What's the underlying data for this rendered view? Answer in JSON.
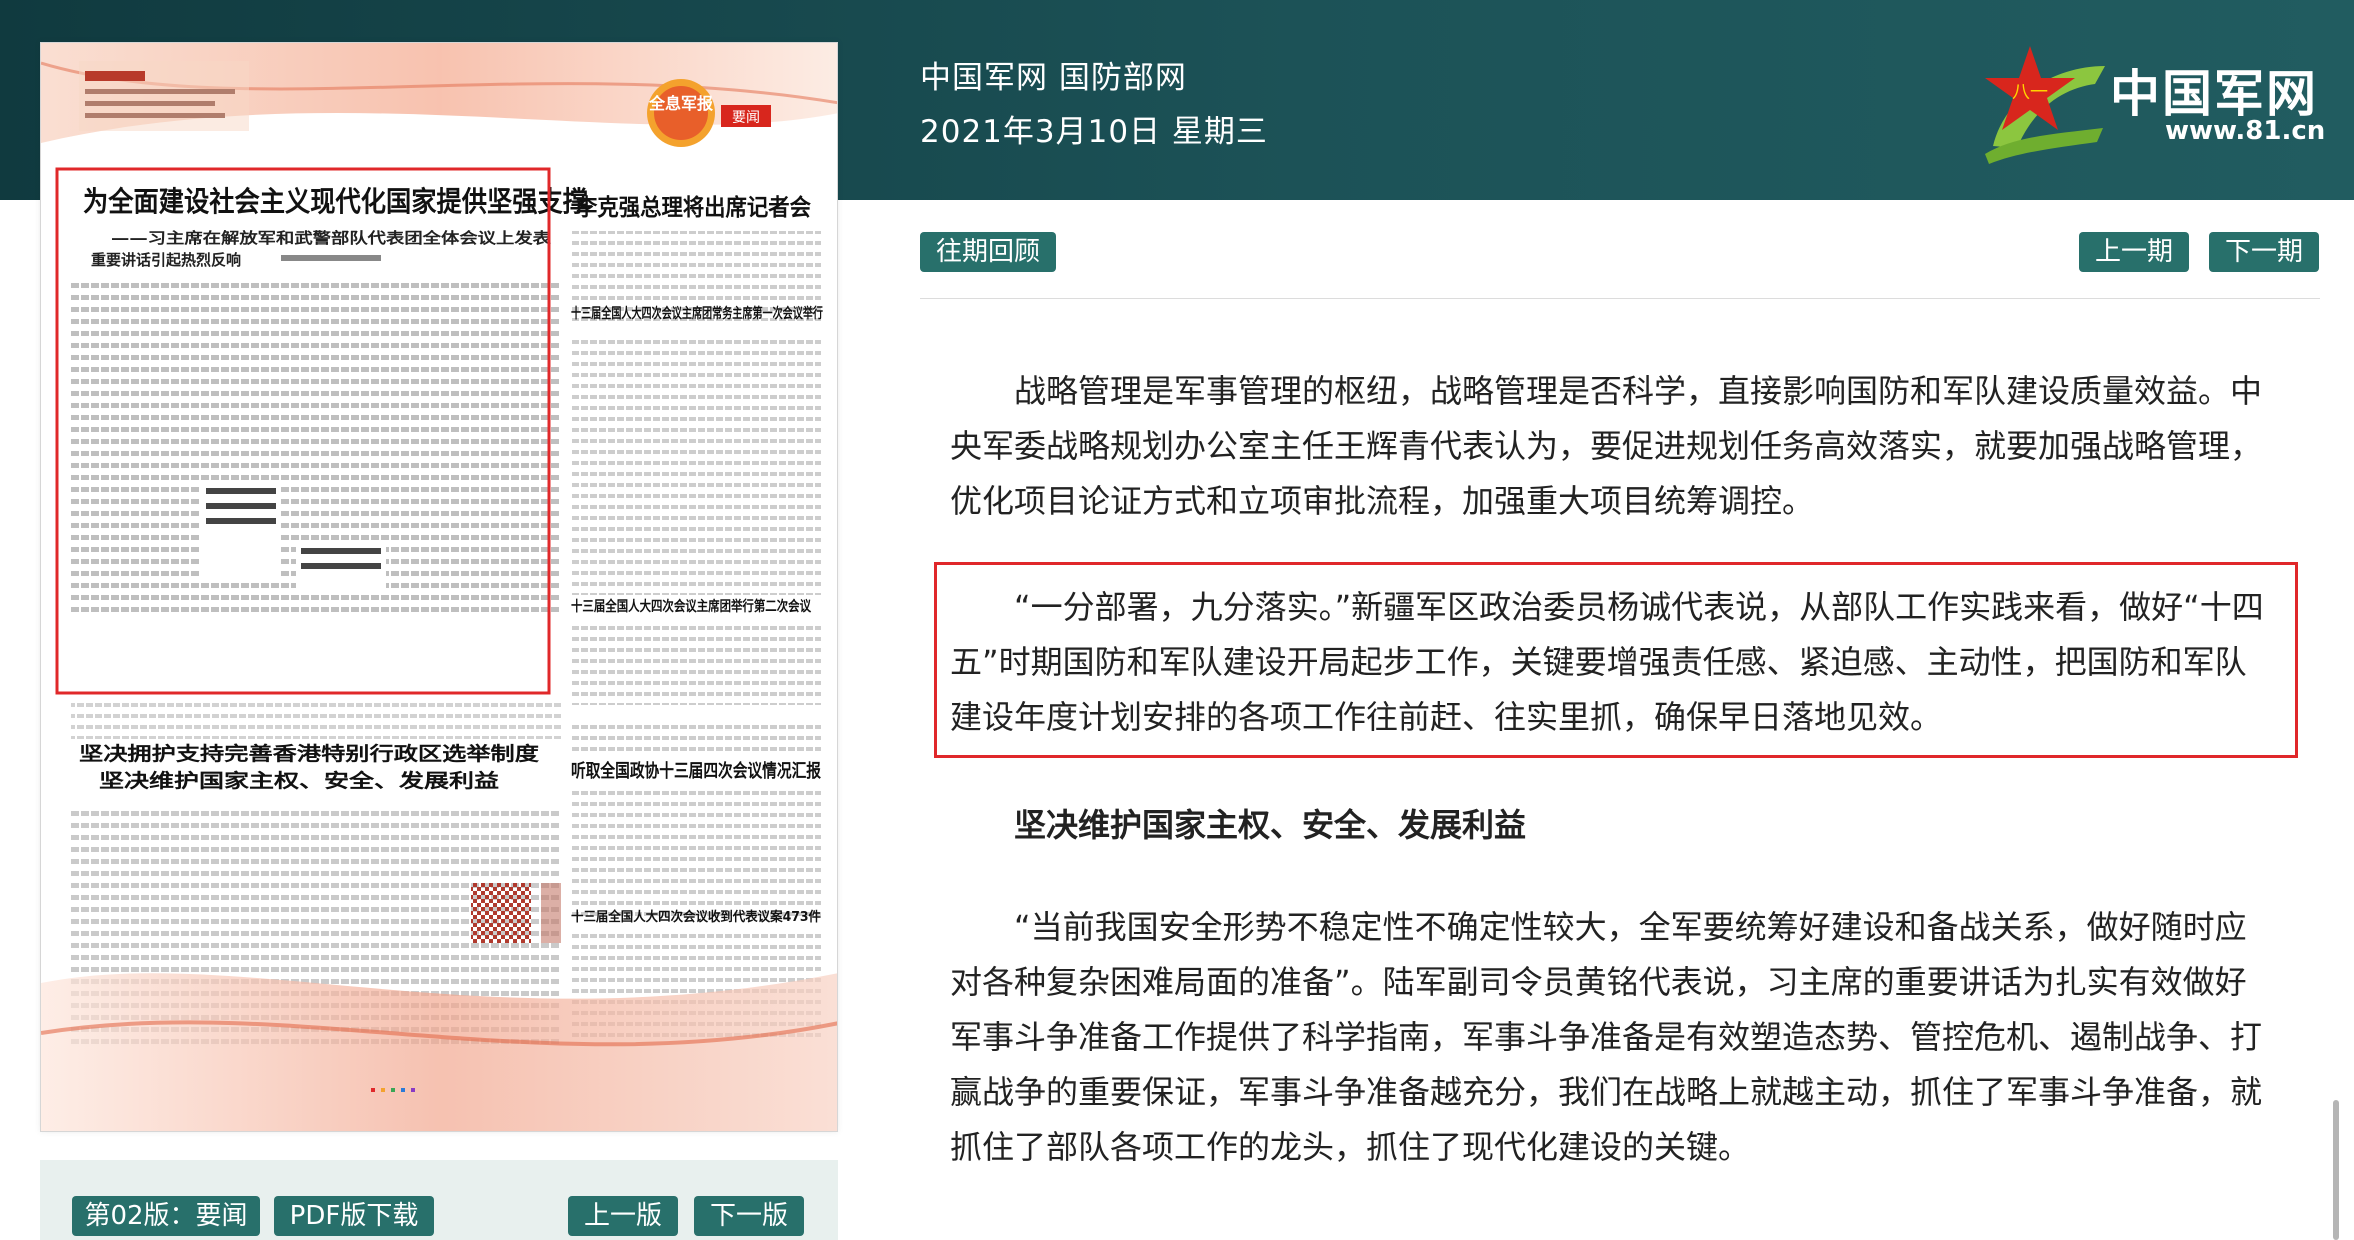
{
  "header": {
    "site_name": "中国军网 国防部网",
    "date": "2021年3月10日 星期三",
    "logo_text": "中国军网",
    "logo_url": "www.81.cn",
    "logo_star_text": "八一"
  },
  "toolbar": {
    "archive_label": "往期回顾",
    "prev_issue_label": "上一期",
    "next_issue_label": "下一期"
  },
  "paper": {
    "page_label": "第02版：要闻",
    "pdf_label": "PDF版下载",
    "prev_page_label": "上一版",
    "next_page_label": "下一版",
    "badge_text": "全息军报",
    "section_tag": "要闻",
    "main_headline": "为全面建设社会主义现代化国家提供坚强支撑",
    "main_subhead": "——习主席在解放军和武警部队代表团全体会议上发表",
    "main_subhead_2": "重要讲话引起热烈反响",
    "right_headline_1": "李克强总理将出席记者会",
    "right_headline_2": "十三届全国人大四次会议主席团常务主席第一次会议举行",
    "right_headline_3": "十三届全国人大四次会议主席团举行第二次会议",
    "lower_headline_1": "坚决拥护支持完善香港特别行政区选举制度",
    "lower_headline_2": "坚决维护国家主权、安全、发展利益",
    "lower_right_headline": "听取全国政协十三届四次会议情况汇报",
    "lower_right_small": "十三届全国人大四次会议收到代表议案473件"
  },
  "article": {
    "para_1": "战略管理是军事管理的枢纽，战略管理是否科学，直接影响国防和军队建设质量效益。中央军委战略规划办公室主任王辉青代表认为，要促进规划任务高效落实，就要加强战略管理，优化项目论证方式和立项审批流程，加强重大项目统筹调控。",
    "para_2": "“一分部署，九分落实。”新疆军区政治委员杨诚代表说，从部队工作实践来看，做好“十四五”时期国防和军队建设开局起步工作，关键要增强责任感、紧迫感、主动性，把国防和军队建设年度计划安排的各项工作往前赶、往实里抓，确保早日落地见效。",
    "heading_1": "坚决维护国家主权、安全、发展利益",
    "para_3": "“当前我国安全形势不稳定性不确定性较大，全军要统筹好建设和备战关系，做好随时应对各种复杂困难局面的准备”。陆军副司令员黄铭代表说，习主席的重要讲话为扎实有效做好军事斗争准备工作提供了科学指南，军事斗争准备是有效塑造态势、管控危机、遏制战争、打赢战争的重要保证，军事斗争准备越充分，我们在战略上就越主动，抓住了军事斗争准备，就抓住了部队各项工作的龙头，抓住了现代化建设的关键。"
  },
  "colors": {
    "header_bg": "#1c5257",
    "button_bg": "#28706b",
    "highlight": "#e0282a",
    "logo_green": "#8cc63f",
    "star_red": "#d8261d"
  }
}
